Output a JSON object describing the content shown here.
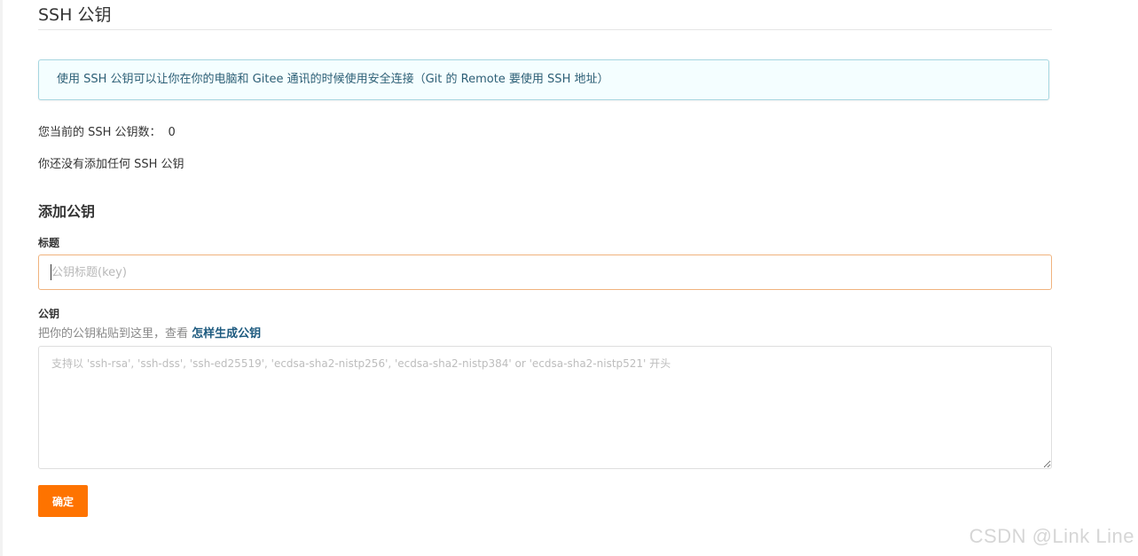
{
  "header": {
    "title": "SSH 公钥"
  },
  "info": {
    "message": "使用 SSH 公钥可以让你在你的电脑和 Gitee 通讯的时候使用安全连接（Git 的 Remote 要使用 SSH 地址）"
  },
  "status": {
    "count_label": "您当前的 SSH 公钥数：",
    "count_value": "0",
    "empty_message": "你还没有添加任何 SSH 公钥"
  },
  "form": {
    "heading": "添加公钥",
    "title_label": "标题",
    "title_placeholder": "公钥标题(key)",
    "key_label": "公钥",
    "hint_prefix": "把你的公钥粘贴到这里，查看 ",
    "hint_link": "怎样生成公钥",
    "key_placeholder": "支持以 'ssh-rsa', 'ssh-dss', 'ssh-ed25519', 'ecdsa-sha2-nistp256', 'ecdsa-sha2-nistp384' or 'ecdsa-sha2-nistp521' 开头",
    "submit_label": "确定"
  },
  "watermark": {
    "text": "CSDN @Link Line"
  },
  "colors": {
    "accent": "#fe7300",
    "info_border": "#a6d6e0",
    "info_background": "#f4feff",
    "link": "#1d5a7f",
    "focus_border": "#f0b37e"
  }
}
